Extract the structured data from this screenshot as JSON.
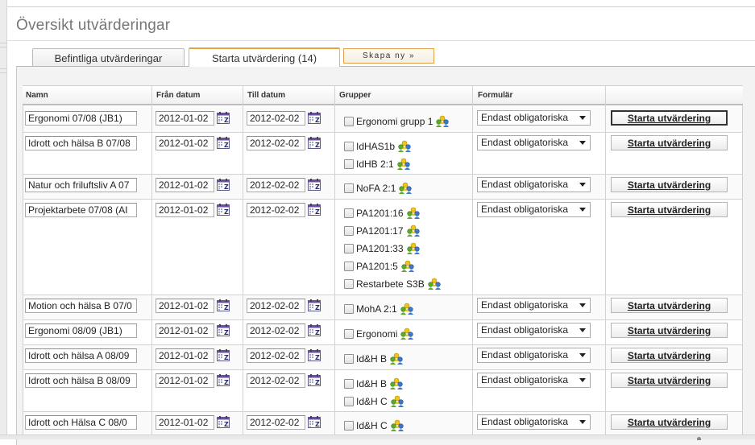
{
  "page": {
    "title": "Översikt utvärderingar"
  },
  "tabs": [
    {
      "label": "Befintliga utvärderingar",
      "active": false
    },
    {
      "label": "Starta utvärdering (14)",
      "active": true
    }
  ],
  "create_button": {
    "label": "Skapa ny »"
  },
  "table": {
    "headers": {
      "name": "Namn",
      "from": "Från datum",
      "to": "Till datum",
      "groups": "Grupper",
      "form": "Formulär",
      "action": ""
    },
    "rows": [
      {
        "name": "Ergonomi 07/08 (JB1)",
        "from": "2012-01-02",
        "to": "2012-02-02",
        "groups": [
          "Ergonomi grupp 1"
        ],
        "form": "Endast obligatoriska",
        "action": "Starta utvärdering"
      },
      {
        "name": "Idrott och hälsa B 07/08",
        "from": "2012-01-02",
        "to": "2012-02-02",
        "groups": [
          "IdHAS1b",
          "IdHB 2:1"
        ],
        "form": "Endast obligatoriska",
        "action": "Starta utvärdering"
      },
      {
        "name": "Natur och friluftsliv A 07",
        "from": "2012-01-02",
        "to": "2012-02-02",
        "groups": [
          "NoFA 2:1"
        ],
        "form": "Endast obligatoriska",
        "action": "Starta utvärdering"
      },
      {
        "name": "Projektarbete 07/08 (AI",
        "from": "2012-01-02",
        "to": "2012-02-02",
        "groups": [
          "PA1201:16",
          "PA1201:17",
          "PA1201:33",
          "PA1201:5",
          "Restarbete S3B"
        ],
        "form": "Endast obligatoriska",
        "action": "Starta utvärdering"
      },
      {
        "name": "Motion och hälsa B 07/0",
        "from": "2012-01-02",
        "to": "2012-02-02",
        "groups": [
          "MohA 2:1"
        ],
        "form": "Endast obligatoriska",
        "action": "Starta utvärdering"
      },
      {
        "name": "Ergonomi 08/09 (JB1)",
        "from": "2012-01-02",
        "to": "2012-02-02",
        "groups": [
          "Ergonomi"
        ],
        "form": "Endast obligatoriska",
        "action": "Starta utvärdering"
      },
      {
        "name": "Idrott och hälsa A 08/09",
        "from": "2012-01-02",
        "to": "2012-02-02",
        "groups": [
          "Id&H B"
        ],
        "form": "Endast obligatoriska",
        "action": "Starta utvärdering"
      },
      {
        "name": "Idrott och hälsa B 08/09",
        "from": "2012-01-02",
        "to": "2012-02-02",
        "groups": [
          "Id&H B",
          "Id&H C"
        ],
        "form": "Endast obligatoriska",
        "action": "Starta utvärdering"
      },
      {
        "name": "Idrott och Hälsa C 08/0",
        "from": "2012-01-02",
        "to": "2012-02-02",
        "groups": [
          "Id&H C"
        ],
        "form": "Endast obligatoriska",
        "action": "Starta utvärdering"
      }
    ]
  },
  "icons": {
    "calendar": "calendar-icon",
    "group": "group-people-icon",
    "select_arrow": "dropdown-arrow-icon"
  },
  "colors": {
    "active_tab_accent": "#e5a33b",
    "create_button_border": "#e0a24d",
    "group_icon_yellow": "#f0c419",
    "group_icon_green": "#5caa2a",
    "group_icon_blue": "#3a78c9"
  }
}
